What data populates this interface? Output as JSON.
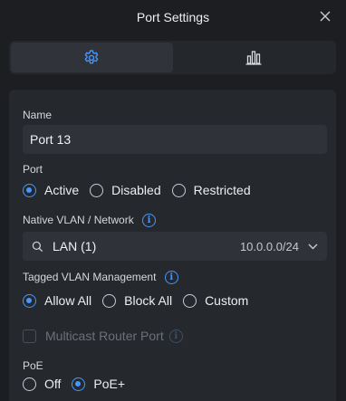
{
  "header": {
    "title": "Port Settings"
  },
  "tabs": [
    {
      "icon": "gear-icon",
      "active": true
    },
    {
      "icon": "bar-chart-icon",
      "active": false
    }
  ],
  "form": {
    "name_label": "Name",
    "name_value": "Port 13",
    "port_label": "Port",
    "port_options": [
      "Active",
      "Disabled",
      "Restricted"
    ],
    "port_selected": "Active",
    "vlan_label": "Native VLAN / Network",
    "vlan_value": "LAN (1)",
    "vlan_subnet": "10.0.0.0/24",
    "tagged_label": "Tagged VLAN Management",
    "tagged_options": [
      "Allow All",
      "Block All",
      "Custom"
    ],
    "tagged_selected": "Allow All",
    "multicast_label": "Multicast Router Port",
    "poe_label": "PoE",
    "poe_options": [
      "Off",
      "PoE+"
    ],
    "poe_selected": "PoE+"
  },
  "colors": {
    "accent": "#4797ff",
    "background": "#1c1e22",
    "panel": "#25282d",
    "field": "#2f3238"
  }
}
